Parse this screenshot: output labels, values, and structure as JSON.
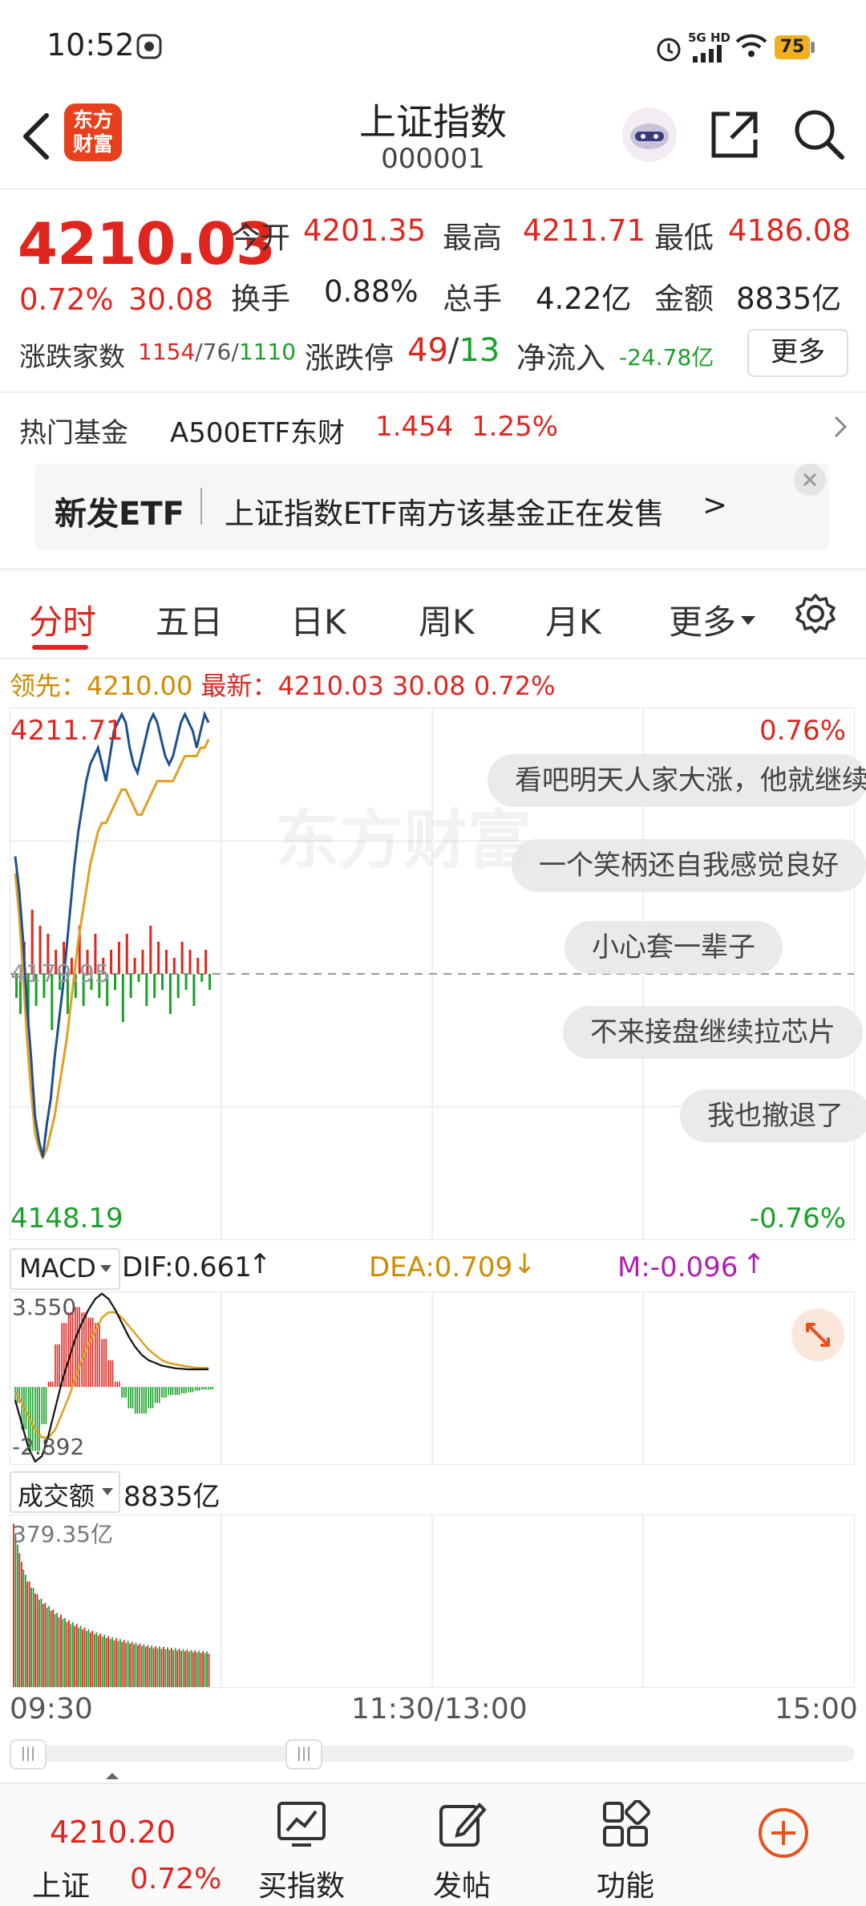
{
  "status_bar": {
    "time": "10:52",
    "network": "5G HD",
    "battery": "75"
  },
  "header": {
    "logo_text": "东方财富",
    "title": "上证指数",
    "code": "000001"
  },
  "quote": {
    "price": "4210.03",
    "change_pct": "0.72%",
    "change": "30.08",
    "open_label": "今开",
    "open": "4201.35",
    "high_label": "最高",
    "high": "4211.71",
    "low_label": "最低",
    "low": "4186.08",
    "turnover_label": "换手",
    "turnover": "0.88%",
    "volume_label": "总手",
    "volume": "4.22亿",
    "amount_label": "金额",
    "amount": "8835亿",
    "breadth_label": "涨跌家数",
    "breadth_up": "1154",
    "breadth_flat": "76",
    "breadth_down": "1110",
    "limit_label": "涨跌停",
    "limit_up": "49",
    "limit_down": "13",
    "inflow_label": "净流入",
    "inflow": "-24.78亿",
    "more_label": "更多"
  },
  "hot_fund": {
    "label": "热门基金",
    "name": "A500ETF东财",
    "price": "1.454",
    "pct": "1.25%"
  },
  "banner": {
    "tag": "新发ETF",
    "text": "上证指数ETF南方该基金正在发售",
    "arrow": ">"
  },
  "tabs": [
    "分时",
    "五日",
    "日K",
    "周K",
    "月K",
    "更多"
  ],
  "chart_info": {
    "lead_label": "领先：",
    "lead": "4210.00",
    "latest_label": "最新：",
    "latest": "4210.03",
    "chg": "30.08",
    "pct": "0.72%"
  },
  "danmaku": [
    "看吧明天人家大涨，他就继续",
    "一个笑柄还自我感觉良好",
    "小心套一辈子",
    "不来接盘继续拉芯片",
    "我也撤退了"
  ],
  "watermark": "东方财富",
  "macd_info": {
    "name": "MACD",
    "dif": "DIF:0.661",
    "dea": "DEA:0.709",
    "m": "M:-0.096"
  },
  "vol_info": {
    "name": "成交额",
    "value": "8835亿"
  },
  "time_axis": [
    "09:30",
    "11:30/13:00",
    "15:00"
  ],
  "colors": {
    "up": "#e0251f",
    "down": "#1aa02a",
    "price_line": "#1f4f8f",
    "avg_line": "#e0a020"
  },
  "chart_data": [
    {
      "type": "line",
      "title": "",
      "y_top": "4211.71",
      "y_bottom": "4148.19",
      "pct_top": "0.76%",
      "pct_bottom": "-0.76%",
      "prev_close_label": "4179.95",
      "ylim": [
        4148.19,
        4211.71
      ],
      "prev_close": 4179.95,
      "series": [
        {
          "name": "",
          "values": [
            4194,
            4190,
            4184,
            4176,
            4170,
            4163,
            4160,
            4158,
            4162,
            4165,
            4170,
            4174,
            4178,
            4183,
            4188,
            4193,
            4197,
            4200,
            4203,
            4205,
            4206,
            4207,
            4205,
            4203,
            4206,
            4209,
            4210,
            4211,
            4210,
            4207,
            4205,
            4204,
            4206,
            4208,
            4210,
            4211,
            4210,
            4208,
            4206,
            4205,
            4206,
            4208,
            4210,
            4211,
            4210,
            4209,
            4207,
            4209,
            4211,
            4210
          ]
        },
        {
          "name": "",
          "values": [
            4192,
            4187,
            4180,
            4172,
            4166,
            4161,
            4159,
            4158,
            4159,
            4161,
            4163,
            4166,
            4169,
            4172,
            4176,
            4180,
            4184,
            4187,
            4190,
            4193,
            4195,
            4197,
            4198,
            4198,
            4199,
            4200,
            4201,
            4202,
            4202,
            4201,
            4200,
            4199,
            4199,
            4200,
            4201,
            4202,
            4203,
            4203,
            4203,
            4203,
            4203,
            4204,
            4205,
            4206,
            4206,
            4206,
            4206,
            4207,
            4207,
            4208
          ]
        }
      ],
      "bars": [
        -3,
        -5,
        4,
        -6,
        8,
        -4,
        6,
        -3,
        5,
        -7,
        3,
        -2,
        4,
        -5,
        2,
        -3,
        6,
        -4,
        3,
        -2,
        5,
        -3,
        2,
        -4,
        3,
        -2,
        4,
        -6,
        5,
        -3,
        2,
        -1,
        3,
        -4,
        6,
        -3,
        4,
        -2,
        3,
        -5,
        2,
        -3,
        4,
        -2,
        3,
        -4,
        2,
        -1,
        3,
        -2
      ]
    },
    {
      "type": "line",
      "title": "",
      "y_top": "3.550",
      "y_bottom": "-2.892",
      "ylim": [
        -2.892,
        3.55
      ],
      "dif": [
        -0.5,
        -1.4,
        -2.3,
        -2.8,
        -2.6,
        -1.8,
        -0.8,
        0.2,
        1.0,
        1.8,
        2.4,
        2.9,
        3.3,
        3.5,
        3.3,
        2.9,
        2.4,
        1.9,
        1.5,
        1.2,
        1.0,
        0.9,
        0.8,
        0.75,
        0.7,
        0.68,
        0.66,
        0.66,
        0.66,
        0.66
      ],
      "dea": [
        -0.2,
        -0.6,
        -1.1,
        -1.6,
        -1.9,
        -1.9,
        -1.6,
        -1.0,
        -0.4,
        0.3,
        1.0,
        1.6,
        2.1,
        2.6,
        2.8,
        2.8,
        2.6,
        2.3,
        2.0,
        1.7,
        1.4,
        1.2,
        1.0,
        0.9,
        0.85,
        0.8,
        0.76,
        0.73,
        0.71,
        0.71
      ],
      "macd": [
        -0.6,
        -1.6,
        -2.4,
        -2.4,
        -1.4,
        0.2,
        1.6,
        2.4,
        2.8,
        3.0,
        2.8,
        2.6,
        2.4,
        1.8,
        1.0,
        0.2,
        -0.4,
        -0.8,
        -1.0,
        -1.0,
        -0.8,
        -0.6,
        -0.4,
        -0.3,
        -0.3,
        -0.24,
        -0.2,
        -0.14,
        -0.1,
        -0.1
      ]
    },
    {
      "type": "bar",
      "title": "",
      "y_top": "379.35亿",
      "ylim": [
        0,
        379.35
      ],
      "values": [
        379,
        330,
        290,
        260,
        245,
        230,
        215,
        205,
        195,
        188,
        180,
        172,
        168,
        160,
        155,
        150,
        146,
        142,
        138,
        134,
        130,
        127,
        124,
        121,
        118,
        115,
        113,
        111,
        109,
        107,
        105,
        103,
        101,
        99,
        97,
        96,
        95,
        94,
        93,
        92,
        91,
        90,
        89,
        88,
        87,
        86,
        85,
        84,
        83,
        82
      ]
    }
  ],
  "bottom_bar": {
    "index_name": "上证",
    "index_price": "4210.20",
    "index_pct": "0.72%",
    "buy_label": "买指数",
    "post_label": "发帖",
    "func_label": "功能"
  }
}
